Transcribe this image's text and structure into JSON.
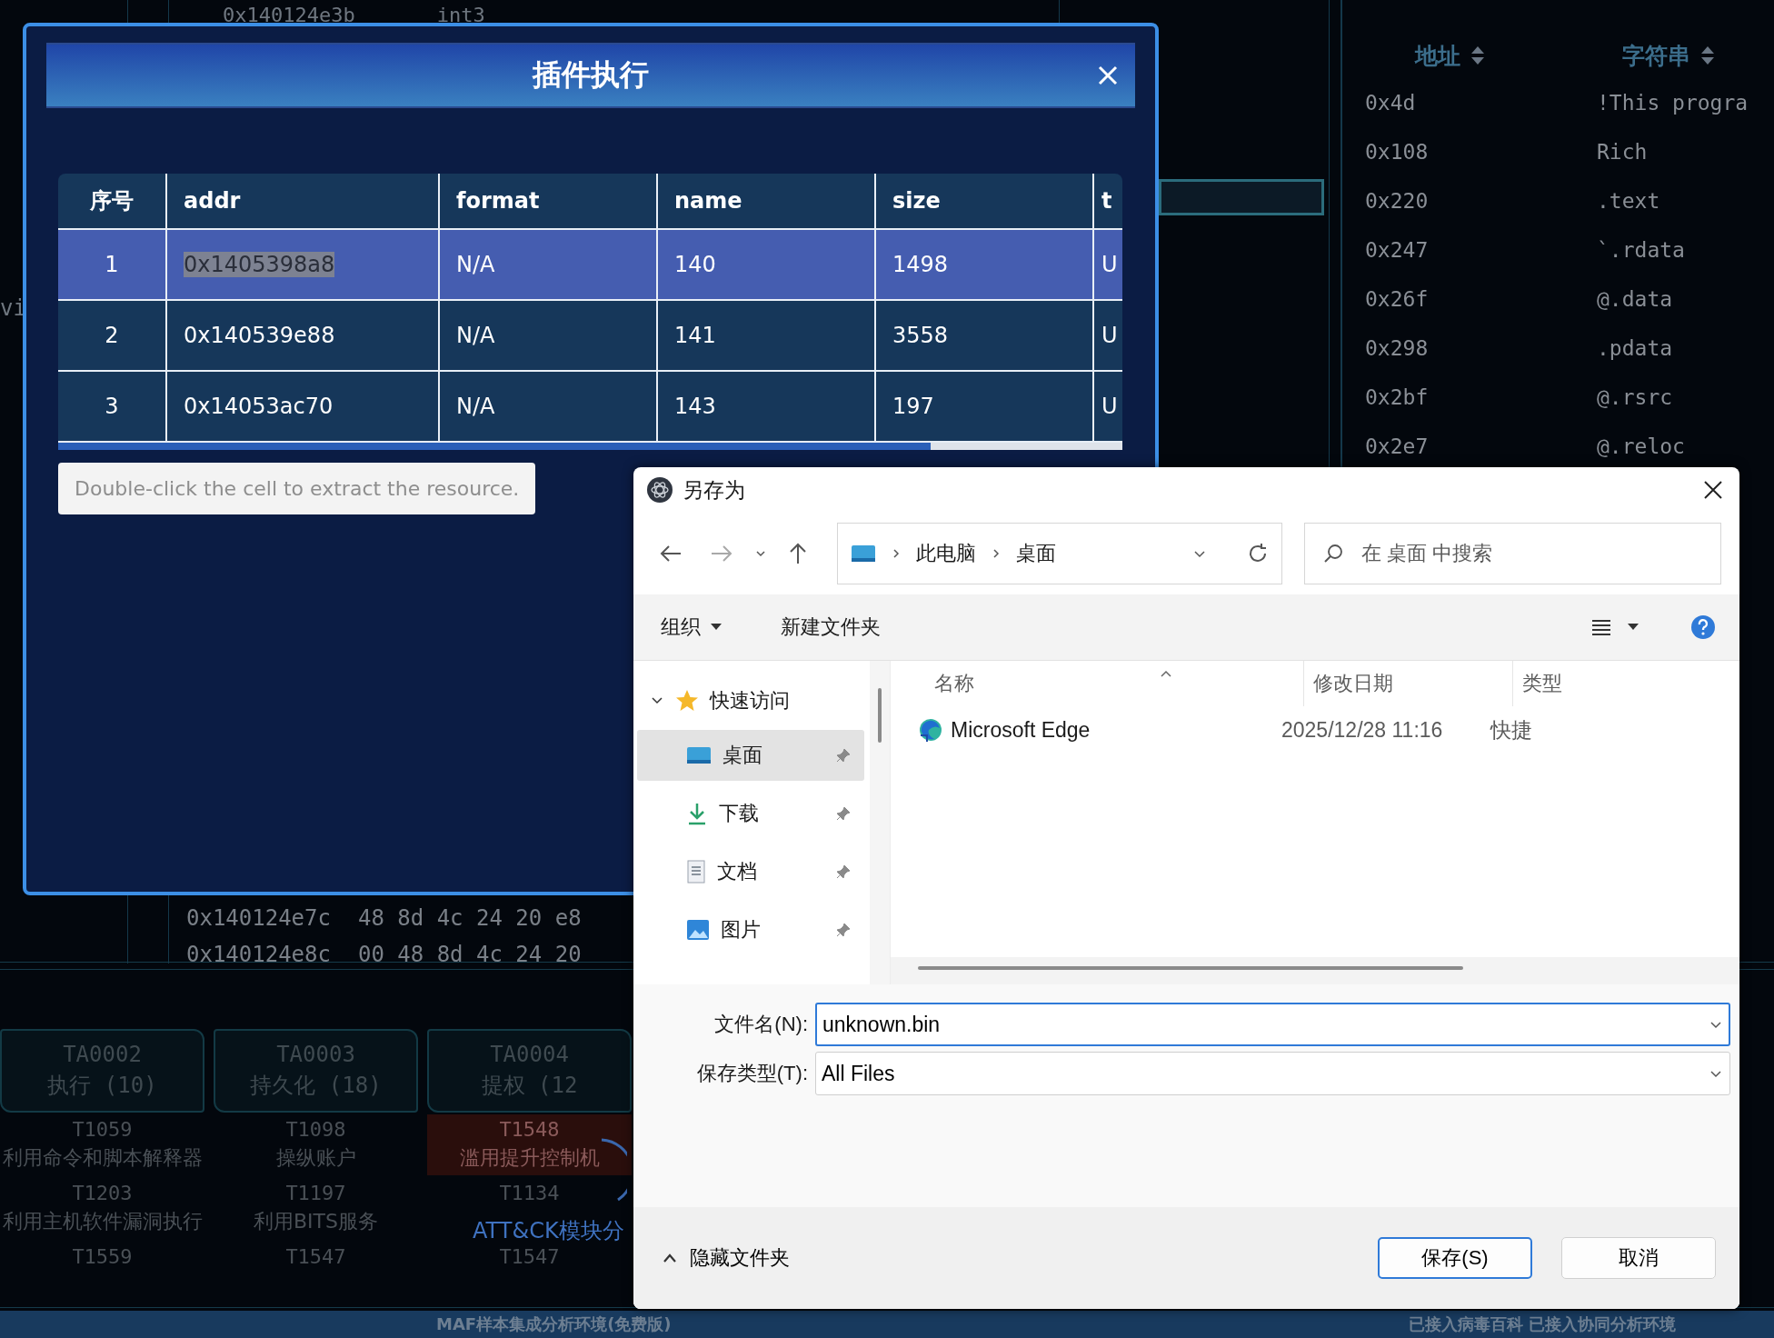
{
  "background": {
    "code_top": {
      "address": "0x140124e3b",
      "instruction": "int3"
    },
    "side_fragment": "vi",
    "strings_panel": {
      "columns": [
        "地址",
        "字符串"
      ],
      "rows": [
        {
          "address": "0x4d",
          "string": "!This progra"
        },
        {
          "address": "0x108",
          "string": "Rich"
        },
        {
          "address": "0x220",
          "string": ".text"
        },
        {
          "address": "0x247",
          "string": "`.rdata"
        },
        {
          "address": "0x26f",
          "string": "@.data"
        },
        {
          "address": "0x298",
          "string": ".pdata"
        },
        {
          "address": "0x2bf",
          "string": "@.rsrc"
        },
        {
          "address": "0x2e7",
          "string": "@.reloc"
        }
      ]
    },
    "hex_rows": [
      {
        "address": "0x140124e7c",
        "bytes": "48 8d 4c 24 20 e8"
      },
      {
        "address": "0x140124e8c",
        "bytes": "00 48 8d 4c 24 20"
      }
    ],
    "tactics": [
      {
        "id": "TA0002",
        "name": "执行 (10)"
      },
      {
        "id": "TA0003",
        "name": "持久化 (18)"
      },
      {
        "id": "TA0004",
        "name": "提权 (12"
      }
    ],
    "techniques": [
      {
        "id": "T1059",
        "name": "利用命令和脚本解释器",
        "highlighted": false
      },
      {
        "id": "T1098",
        "name": "操纵账户",
        "highlighted": false
      },
      {
        "id": "T1548",
        "name": "滥用提升控制机",
        "highlighted": true
      },
      {
        "id": "T1203",
        "name": "利用主机软件漏洞执行",
        "highlighted": false
      },
      {
        "id": "T1197",
        "name": "利用BITS服务",
        "highlighted": false
      },
      {
        "id": "T1134",
        "highlighted": false
      },
      {
        "id": "T1559",
        "highlighted": false
      },
      {
        "id": "T1547",
        "highlighted": false
      },
      {
        "id": "T1547",
        "highlighted": false
      }
    ],
    "loading_text": "ATT&CK模块分",
    "status_bar": [
      "MAF样本集成分析环境(免费版)",
      "已接入病毒百科 已接入协同分析环境"
    ]
  },
  "plugin_dialog": {
    "title": "插件执行",
    "columns": [
      "序号",
      "addr",
      "format",
      "name",
      "size",
      "t"
    ],
    "rows": [
      {
        "cells": [
          "1",
          "0x1405398a8",
          "N/A",
          "140",
          "1498",
          "U"
        ],
        "selected": true,
        "addr_selected": true
      },
      {
        "cells": [
          "2",
          "0x140539e88",
          "N/A",
          "141",
          "3558",
          "U"
        ],
        "selected": false,
        "addr_selected": false
      },
      {
        "cells": [
          "3",
          "0x14053ac70",
          "N/A",
          "143",
          "197",
          "U"
        ],
        "selected": false,
        "addr_selected": false
      }
    ],
    "hint": "Double-click the cell to extract the resource."
  },
  "save_dialog": {
    "title": "另存为",
    "nav": {
      "forward_disabled": true
    },
    "breadcrumb": [
      "此电脑",
      "桌面"
    ],
    "search": {
      "placeholder": "在 桌面 中搜索"
    },
    "toolbar": {
      "organize": "组织",
      "new_folder": "新建文件夹"
    },
    "sidebar": {
      "group": {
        "label": "快速访问",
        "expanded": true,
        "items": [
          {
            "label": "桌面",
            "kind": "desktop",
            "selected": true
          },
          {
            "label": "下载",
            "kind": "download",
            "selected": false
          },
          {
            "label": "文档",
            "kind": "document",
            "selected": false
          },
          {
            "label": "图片",
            "kind": "pictures",
            "selected": false
          }
        ]
      }
    },
    "columns": [
      "名称",
      "修改日期",
      "类型"
    ],
    "files": [
      {
        "name": "Microsoft Edge",
        "modified": "2025/12/28 11:16",
        "type": "快捷"
      }
    ],
    "filename": {
      "label": "文件名(N):",
      "value": "unknown.bin"
    },
    "filetype": {
      "label": "保存类型(T):",
      "value": "All Files"
    },
    "hide_folders": "隐藏文件夹",
    "buttons": [
      {
        "label": "保存(S)",
        "primary": true
      },
      {
        "label": "取消",
        "primary": false
      }
    ]
  }
}
